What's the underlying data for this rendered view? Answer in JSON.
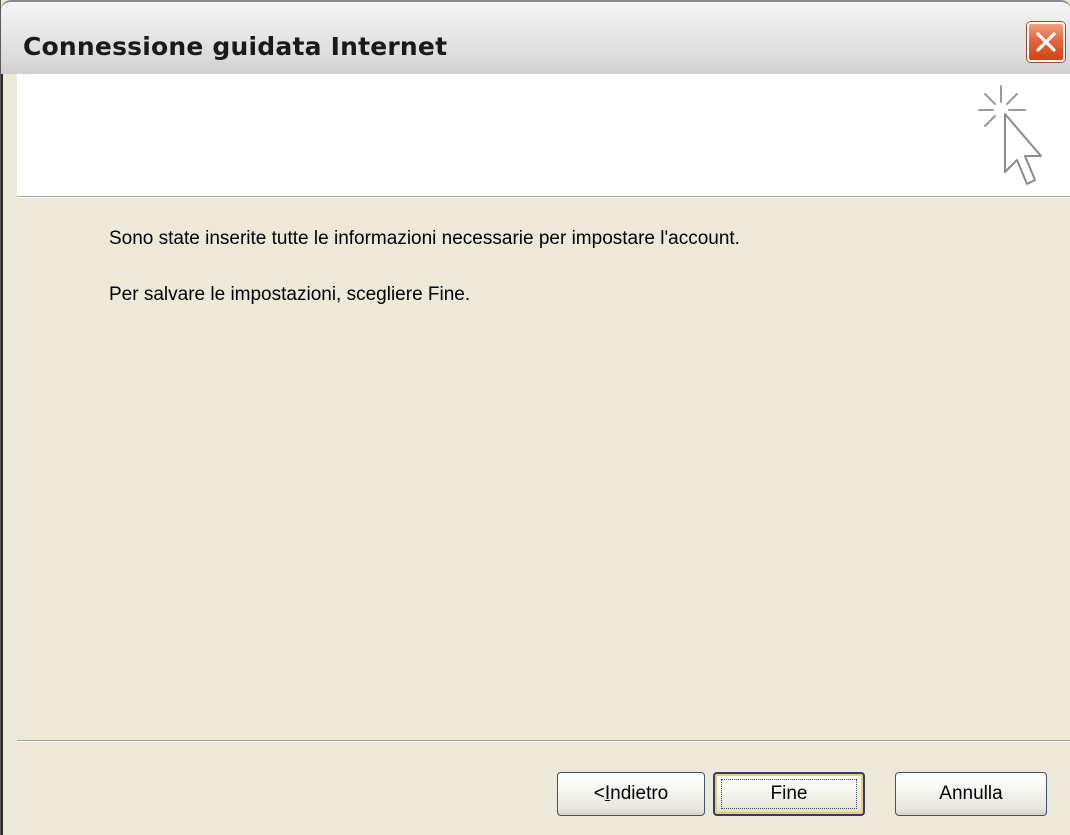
{
  "window": {
    "title": "Connessione guidata Internet"
  },
  "header": {
    "icon": "wizard-cursor-sparkle-icon"
  },
  "body": {
    "line1": "Sono state inserite tutte le informazioni necessarie per impostare l'account.",
    "line2": "Per salvare le impostazioni, scegliere Fine."
  },
  "buttons": {
    "back_prefix": "< ",
    "back_accel": "I",
    "back_rest": "ndietro",
    "finish": "Fine",
    "cancel": "Annulla"
  },
  "colors": {
    "close_button": "#e2673d",
    "dialog_background": "#ece9d8",
    "header_background": "#ffffff"
  }
}
